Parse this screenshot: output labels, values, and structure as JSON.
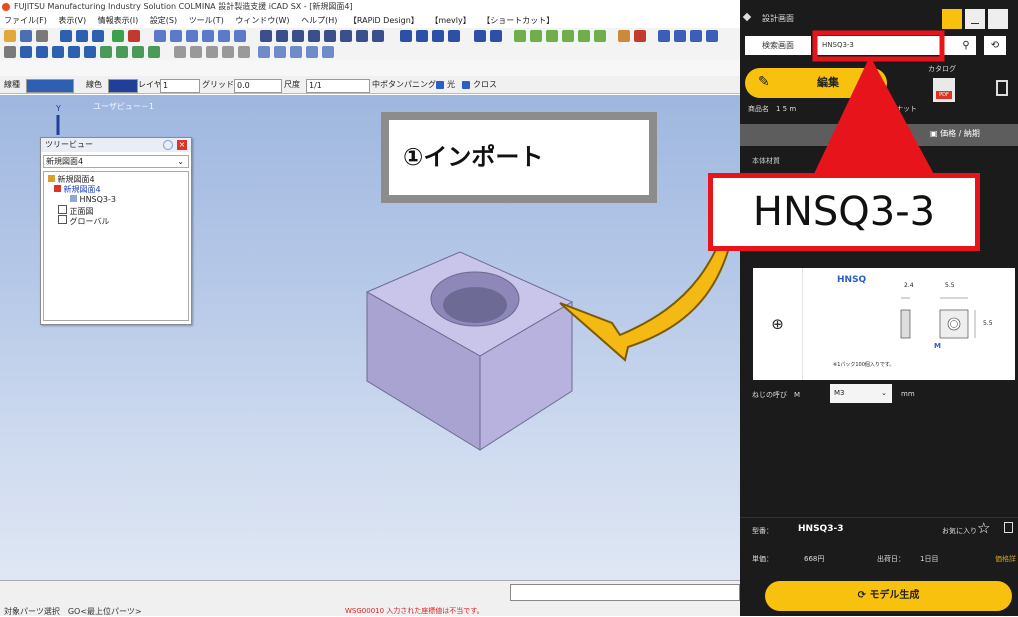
{
  "window": {
    "title": "FUJITSU Manufacturing Industry Solution COLMINA 設計製造支援 iCAD SX - [新規図面4]"
  },
  "menu": [
    "ファイル(F)",
    "表示(V)",
    "情報表示(I)",
    "設定(S)",
    "ツール(T)",
    "ウィンドウ(W)",
    "ヘルプ(H)",
    "【RAPiD Design】",
    "【mevly】",
    "【ショートカット】"
  ],
  "propbar": {
    "line_type_label": "線種",
    "line_color_label": "線色",
    "layer_label": "レイヤ",
    "layer_value": "1",
    "grid_label": "グリッド",
    "grid_value": "0.0",
    "scale_label": "尺度",
    "scale_value": "1/1",
    "snap_label": "中ポタンパニング",
    "light_label": "光",
    "cross_label": "クロス"
  },
  "canvas": {
    "view_label": "ユーザビュー－1",
    "axis_y": "Y"
  },
  "tree": {
    "title": "ツリービュー",
    "combo_value": "新規図面4",
    "nodes": [
      {
        "label": "新規図面4"
      },
      {
        "label": "新規図面4"
      },
      {
        "label": "HNSQ3-3"
      },
      {
        "label": "正面図"
      },
      {
        "label": "グローバル"
      }
    ]
  },
  "annotations": {
    "import_label": "①インポート",
    "part_label": "HNSQ3-3"
  },
  "status": {
    "text": "対象パーツ選択　GO<最上位パーツ>",
    "message": "WSG00010 入力された座標値は不当です。"
  },
  "panel": {
    "title": "設計画面",
    "search_tab": "検索画面",
    "search_value": "HNSQ3-3",
    "edit_button": "編集",
    "catalog_label": "カタログ",
    "pdf_label": "PDF",
    "product_name_prefix": "商品名　1 5 m",
    "product_name_suffix": "用四角ナット",
    "price_tab": "価格 / 納期",
    "material_label": "本体材質",
    "drawing_title": "HNSQ",
    "drawing_note": "※1パック100個入りです。",
    "dim_a": "2.4",
    "dim_b": "5.5",
    "dim_c": "5.5",
    "dim_m": "M",
    "thread_label": "ねじの呼び　M",
    "thread_value": "M3",
    "thread_unit": "mm",
    "model_type_label": "型番：",
    "model_type_value": "HNSQ3-3",
    "favorite_label": "お気に入り",
    "unit_price_label": "単価：",
    "unit_price_value": "668円",
    "ship_label": "出荷日：",
    "ship_value": "1日目",
    "price_detail_link": "価格詳",
    "generate_button": "モデル生成"
  },
  "colors": {
    "accent_yellow": "#f7c10d",
    "highlight_red": "#e8141c",
    "panel_dark": "#1b1b1b"
  }
}
